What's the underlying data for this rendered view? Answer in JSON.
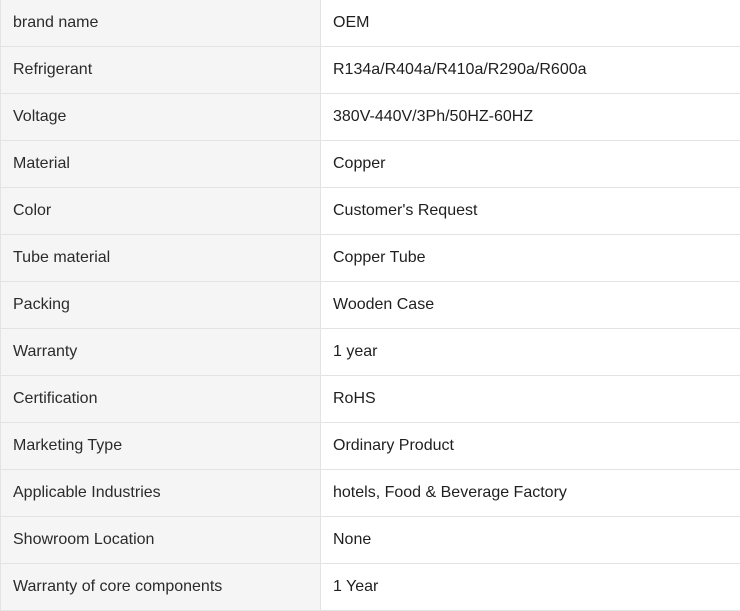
{
  "specs": [
    {
      "label": "brand name",
      "value": "OEM"
    },
    {
      "label": "Refrigerant",
      "value": "R134a/R404a/R410a/R290a/R600a"
    },
    {
      "label": "Voltage",
      "value": "380V-440V/3Ph/50HZ-60HZ"
    },
    {
      "label": "Material",
      "value": "Copper"
    },
    {
      "label": "Color",
      "value": "Customer's Request"
    },
    {
      "label": "Tube material",
      "value": "Copper Tube"
    },
    {
      "label": "Packing",
      "value": "Wooden Case"
    },
    {
      "label": "Warranty",
      "value": "1 year"
    },
    {
      "label": "Certification",
      "value": "RoHS"
    },
    {
      "label": "Marketing Type",
      "value": "Ordinary Product"
    },
    {
      "label": "Applicable Industries",
      "value": "hotels, Food & Beverage Factory"
    },
    {
      "label": "Showroom Location",
      "value": "None"
    },
    {
      "label": "Warranty of core components",
      "value": "1 Year"
    }
  ]
}
